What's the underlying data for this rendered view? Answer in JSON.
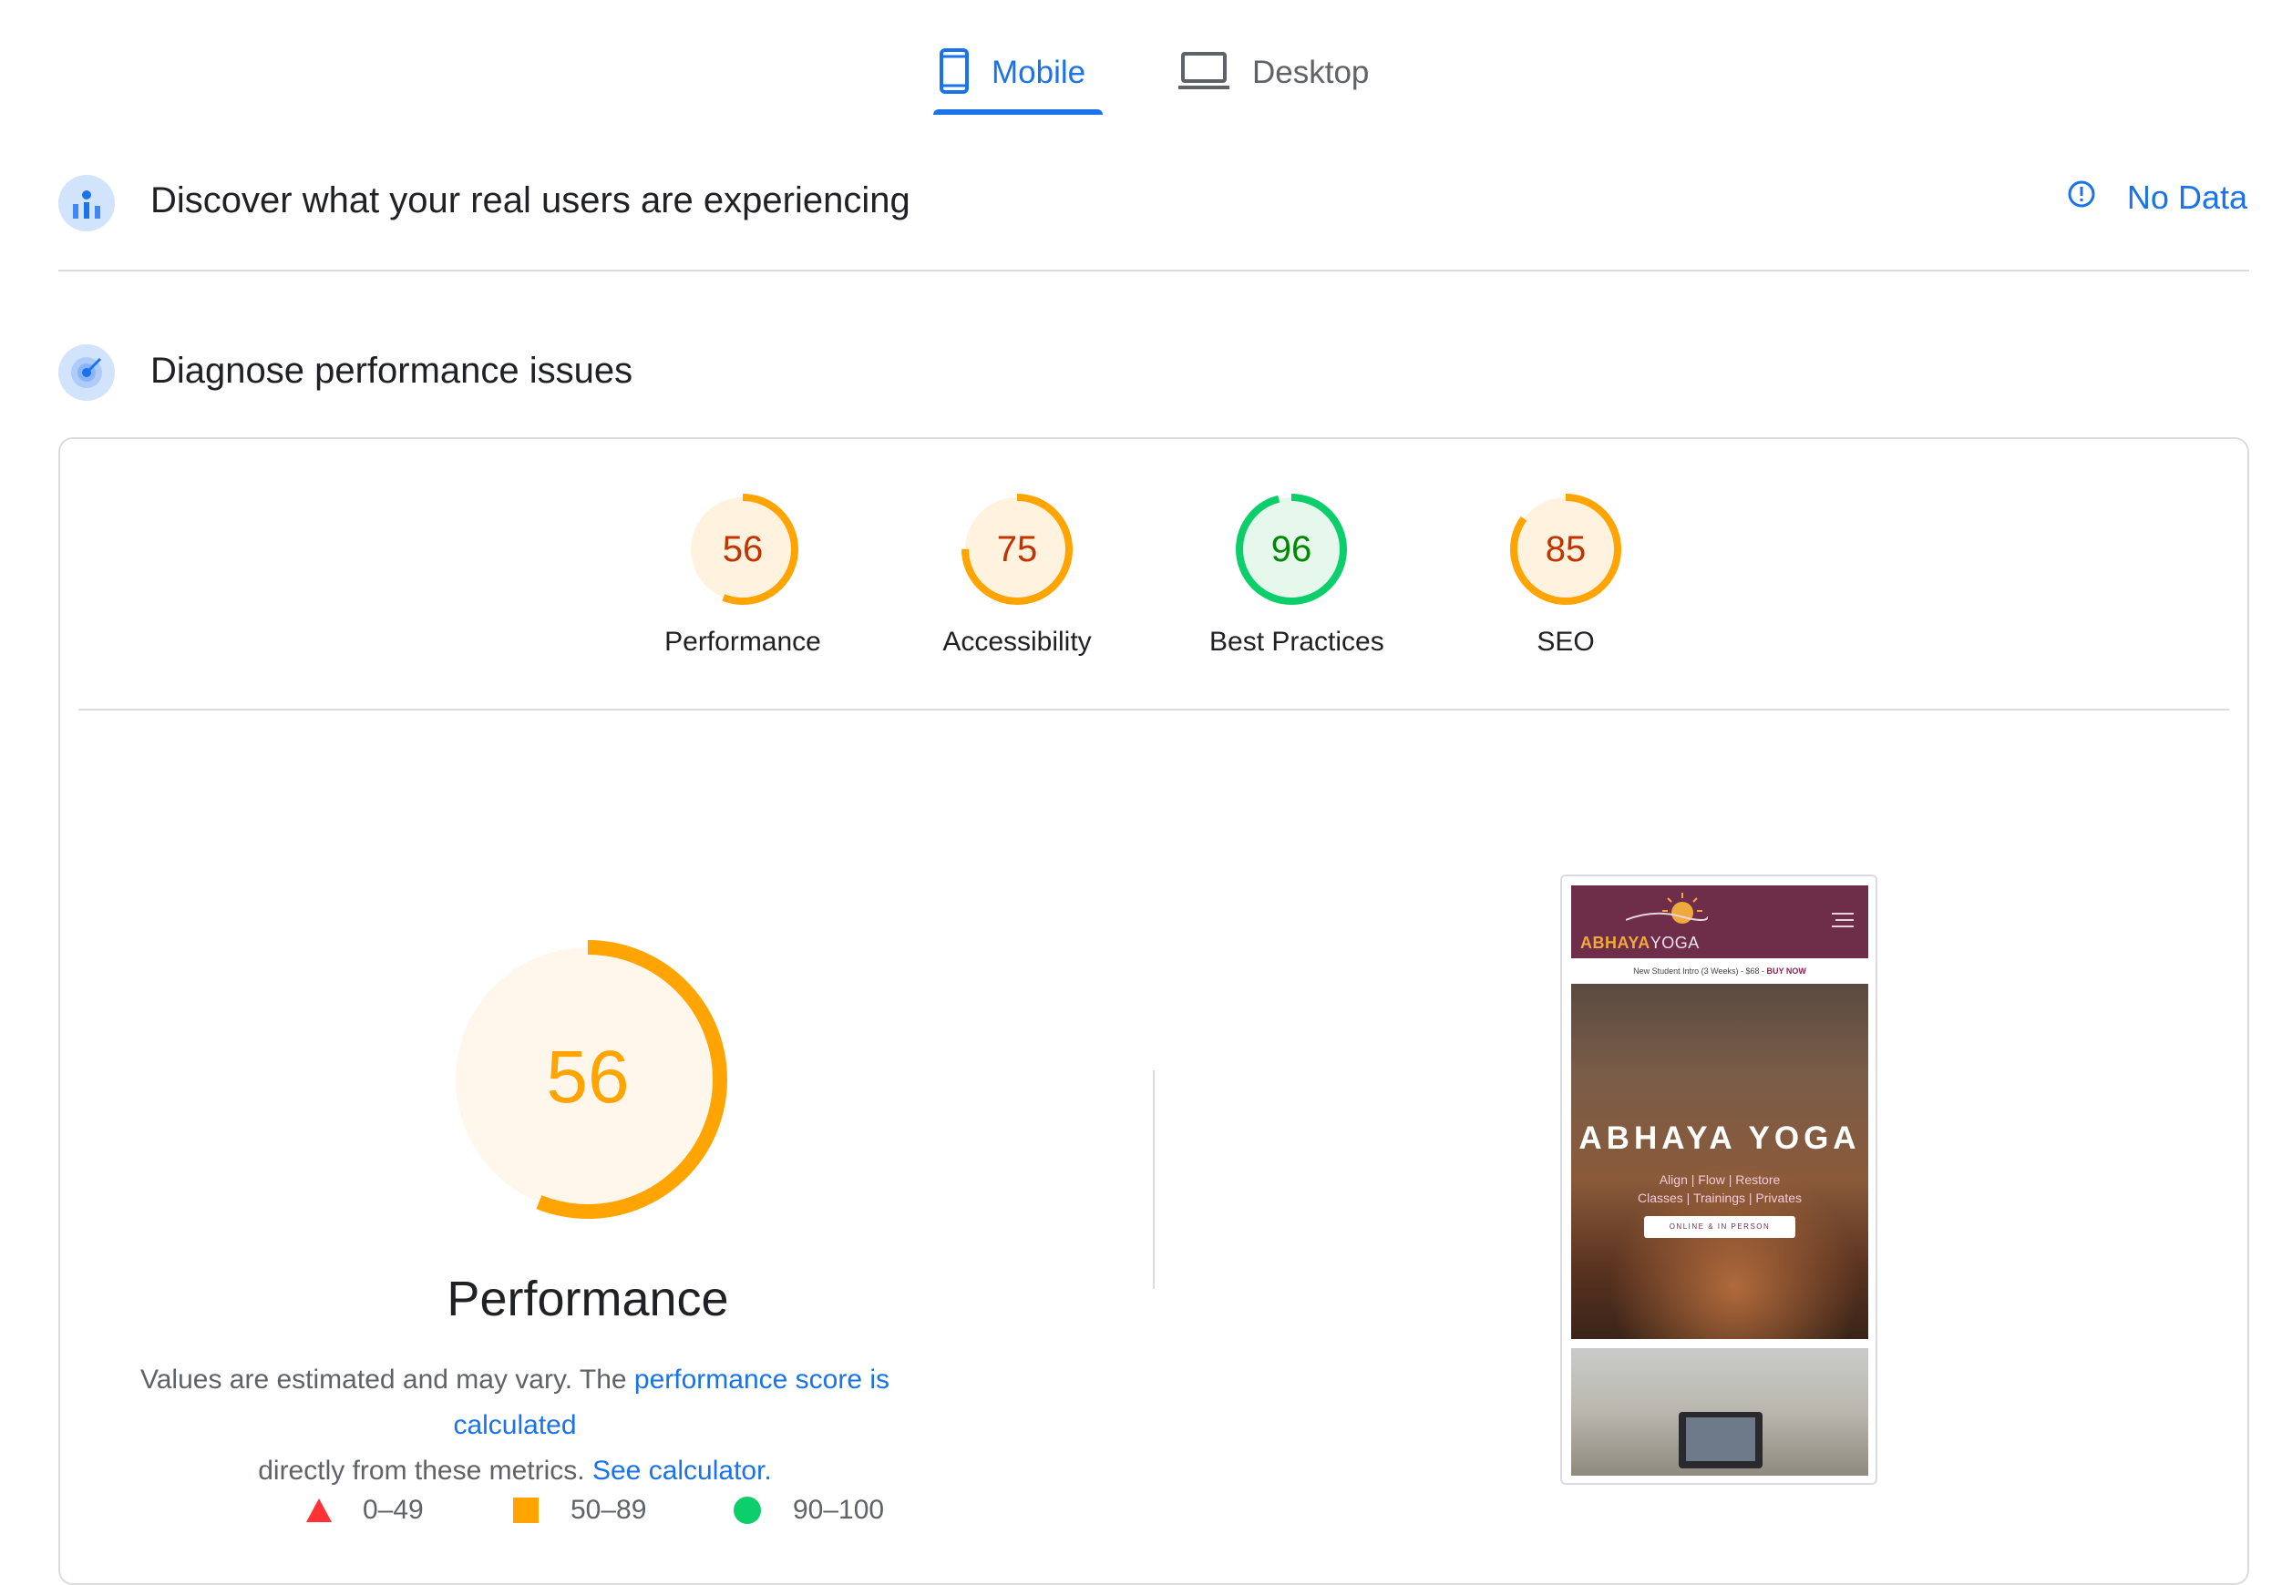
{
  "tabs": [
    {
      "label": "Mobile",
      "active": true
    },
    {
      "label": "Desktop",
      "active": false
    }
  ],
  "field_data": {
    "title": "Discover what your real users are experiencing",
    "status": "No Data"
  },
  "diagnose": {
    "title": "Diagnose performance issues"
  },
  "scores": [
    {
      "label": "Performance",
      "value": 56,
      "status": "average"
    },
    {
      "label": "Accessibility",
      "value": 75,
      "status": "average"
    },
    {
      "label": "Best Practices",
      "value": 96,
      "status": "pass"
    },
    {
      "label": "SEO",
      "value": 85,
      "status": "average"
    }
  ],
  "performance_detail": {
    "score": "56",
    "title": "Performance",
    "desc_prefix": "Values are estimated and may vary. The ",
    "desc_link1": "performance score is calculated",
    "desc_middle": "directly from these metrics. ",
    "desc_link2": "See calculator."
  },
  "legend": [
    {
      "range": "0–49",
      "shape": "triangle",
      "color": "#ff3333"
    },
    {
      "range": "50–89",
      "shape": "square",
      "color": "#ffa400"
    },
    {
      "range": "90–100",
      "shape": "circle",
      "color": "#0cce6b"
    }
  ],
  "screenshot": {
    "brand_main": "ABHAYA",
    "brand_sub": "YOGA",
    "promo_text": "New Student Intro (3 Weeks) - $68 - ",
    "promo_cta": "BUY NOW",
    "hero_title": "ABHAYA YOGA",
    "hero_line1": "Align | Flow | Restore",
    "hero_line2": "Classes | Trainings | Privates",
    "hero_button": "ONLINE & IN PERSON"
  },
  "colors": {
    "accent": "#1a73e8",
    "average": "#ffa400",
    "average_text": "#c33300",
    "pass": "#0cce6b",
    "pass_text": "#008800",
    "fail": "#ff3333"
  }
}
